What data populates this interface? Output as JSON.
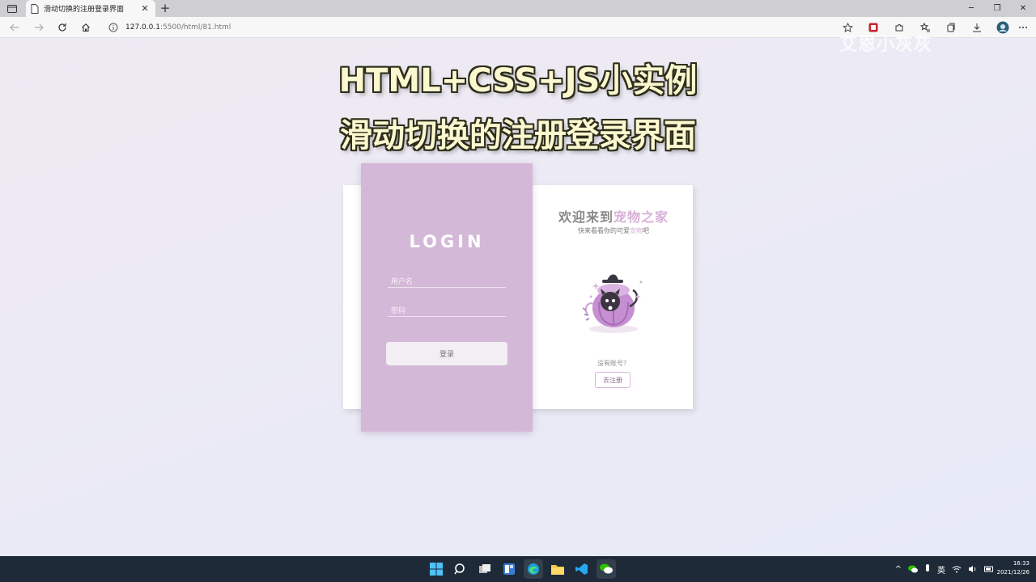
{
  "browser": {
    "tab_title": "滑动切换的注册登录界面",
    "url_host": "127.0.0.1",
    "url_path": ":5500/html/81.html"
  },
  "page": {
    "watermark": "艾恩小灰灰",
    "headline_line1": "HTML+CSS+JS小实例",
    "headline_line2": "滑动切换的注册登录界面"
  },
  "login": {
    "title": "LOGIN",
    "username_placeholder": "用户名",
    "password_placeholder": "密码",
    "submit_label": "登录"
  },
  "welcome": {
    "title_prefix": "欢迎来到",
    "title_accent": "宠物之家",
    "subtitle_prefix": "快来看看你的可爱",
    "subtitle_accent": "宠物",
    "subtitle_suffix": "吧",
    "no_account": "没有账号？",
    "register_label": "去注册"
  },
  "taskbar": {
    "ime": "英",
    "time": "16:33",
    "date": "2021/12/26"
  },
  "colors": {
    "login_panel": "#d4b8d8",
    "accent": "#d7b0d6",
    "headline_fill": "#fbf7cf",
    "taskbar": "#1e2a38"
  }
}
